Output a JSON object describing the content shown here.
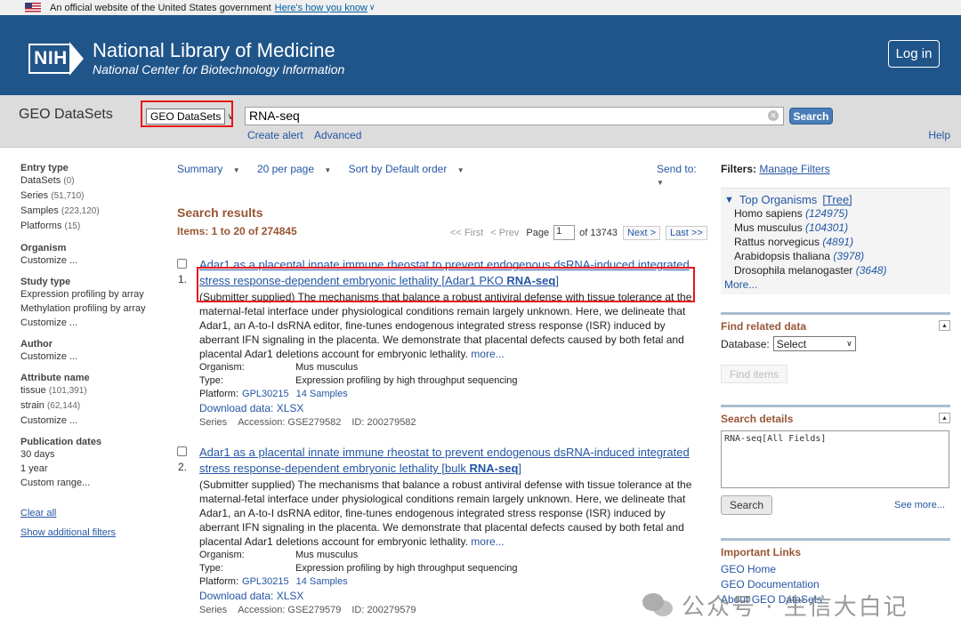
{
  "gov_banner": {
    "text": "An official website of the United States government",
    "link": "Here's how you know"
  },
  "header": {
    "title": "National Library of Medicine",
    "subtitle": "National Center for Biotechnology Information",
    "logo_text": "NIH",
    "login": "Log in"
  },
  "search": {
    "db_label": "GEO DataSets",
    "db_selected": "GEO DataSets",
    "query": "RNA-seq",
    "button": "Search",
    "create_alert": "Create alert",
    "advanced": "Advanced",
    "help": "Help"
  },
  "left_filters": {
    "entry_type": {
      "title": "Entry type",
      "items": [
        {
          "label": "DataSets",
          "count": "(0)"
        },
        {
          "label": "Series",
          "count": "(51,710)"
        },
        {
          "label": "Samples",
          "count": "(223,120)"
        },
        {
          "label": "Platforms",
          "count": "(15)"
        }
      ]
    },
    "organism": {
      "title": "Organism",
      "items": [
        "Customize ..."
      ]
    },
    "study_type": {
      "title": "Study type",
      "items": [
        "Expression profiling by array",
        "Methylation profiling by array",
        "Customize ..."
      ]
    },
    "author": {
      "title": "Author",
      "items": [
        "Customize ..."
      ]
    },
    "attribute": {
      "title": "Attribute name",
      "items": [
        {
          "label": "tissue",
          "count": "(101,391)"
        },
        {
          "label": "strain",
          "count": "(62,144)"
        },
        {
          "label": "Customize ...",
          "count": ""
        }
      ]
    },
    "pub_dates": {
      "title": "Publication dates",
      "items": [
        "30 days",
        "1 year",
        "Custom range..."
      ]
    },
    "clear_all": "Clear all",
    "show_additional": "Show additional filters"
  },
  "toolbar": {
    "summary": "Summary",
    "per_page": "20 per page",
    "sort": "Sort by Default order",
    "send_to": "Send to:"
  },
  "results": {
    "heading": "Search results",
    "items": "Items: 1 to 20 of 274845",
    "pager": {
      "first": "<< First",
      "prev": "< Prev",
      "page_label": "Page",
      "page": "1",
      "of": "of 13743",
      "next": "Next >",
      "last": "Last >>"
    },
    "list": [
      {
        "num": "1.",
        "title": "Adar1 as a placental innate immune rheostat to prevent endogenous dsRNA-induced integrated stress response-dependent embryonic lethality [Adar1 PKO ",
        "title_bold": "RNA-seq",
        "title_end": "]",
        "desc": "(Submitter supplied) The mechanisms that balance a robust antiviral defense with tissue tolerance at the maternal-fetal interface under physiological conditions remain largely unknown. Here, we delineate that Adar1, an A-to-I dsRNA editor, fine-tunes endogenous integrated stress response (ISR) induced by aberrant IFN signaling in the placenta. We demonstrate that placental defects caused by both fetal and placental Adar1 deletions account for embryonic lethality.",
        "more": "more...",
        "organism_k": "Organism:",
        "organism_v": "Mus musculus",
        "type_k": "Type:",
        "type_v": "Expression profiling by high throughput sequencing",
        "platform_k": "Platform:",
        "platform_v": "GPL30215",
        "samples": "14 Samples",
        "download": "Download data: XLSX",
        "series": "Series",
        "accession": "Accession: GSE279582",
        "id": "ID: 200279582"
      },
      {
        "num": "2.",
        "title": "Adar1 as a placental innate immune rheostat to prevent endogenous dsRNA-induced integrated stress response-dependent embryonic lethality [bulk ",
        "title_bold": "RNA-seq",
        "title_end": "]",
        "desc": "(Submitter supplied) The mechanisms that balance a robust antiviral defense with tissue tolerance at the maternal-fetal interface under physiological conditions remain largely unknown. Here, we delineate that Adar1, an A-to-I dsRNA editor, fine-tunes endogenous integrated stress response (ISR) induced by aberrant IFN signaling in the placenta. We demonstrate that placental defects caused by both fetal and placental Adar1 deletions account for embryonic lethality.",
        "more": "more...",
        "organism_k": "Organism:",
        "organism_v": "Mus musculus",
        "type_k": "Type:",
        "type_v": "Expression profiling by high throughput sequencing",
        "platform_k": "Platform:",
        "platform_v": "GPL30215",
        "samples": "14 Samples",
        "download": "Download data: XLSX",
        "series": "Series",
        "accession": "Accession: GSE279579",
        "id": "ID: 200279579"
      }
    ]
  },
  "right": {
    "filters_label": "Filters:",
    "manage": "Manage Filters",
    "top_org": "Top Organisms",
    "tree": "[Tree]",
    "orgs": [
      {
        "name": "Homo sapiens",
        "count": "(124975)"
      },
      {
        "name": "Mus musculus",
        "count": "(104301)"
      },
      {
        "name": "Rattus norvegicus",
        "count": "(4891)"
      },
      {
        "name": "Arabidopsis thaliana",
        "count": "(3978)"
      },
      {
        "name": "Drosophila melanogaster",
        "count": "(3648)"
      }
    ],
    "more": "More...",
    "find_related": "Find related data",
    "database_label": "Database:",
    "database_value": "Select",
    "find_items": "Find items",
    "search_details": "Search details",
    "details_text": "RNA-seq[All Fields]",
    "details_search": "Search",
    "see_more": "See more...",
    "important_links": "Important Links",
    "links": [
      "GEO Home",
      "GEO Documentation",
      "About GEO DataSets"
    ]
  },
  "watermark": {
    "text": "公众号 · 生信大白记"
  }
}
